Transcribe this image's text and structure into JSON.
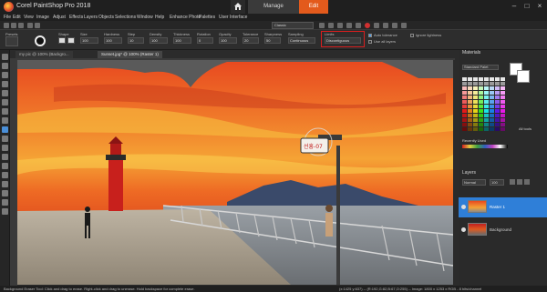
{
  "app": {
    "title": "Corel PaintShop Pro 2018"
  },
  "tabs": {
    "manage": "Manage",
    "edit": "Edit"
  },
  "menu": [
    "File",
    "Edit",
    "View",
    "Image",
    "Adjust",
    "Effects",
    "Layers",
    "Objects",
    "Selections",
    "Window",
    "Help",
    "Enhance Photo",
    "Palettes",
    "User Interface"
  ],
  "toolbar": {
    "workspace_combo": "Classic"
  },
  "options": {
    "labels": {
      "presets": "Presets",
      "shape": "Shape",
      "size": "Size",
      "hardness": "Hardness",
      "step": "Step",
      "density": "Density",
      "thickness": "Thickness",
      "rotation": "Rotation",
      "opacity": "Opacity",
      "tolerance": "Tolerance",
      "sharpness": "Sharpness",
      "sampling": "Sampling",
      "limits": "Limits"
    },
    "values": {
      "size": "100",
      "hardness": "100",
      "step": "10",
      "density": "100",
      "thickness": "100",
      "rotation": "0",
      "opacity": "100",
      "tolerance": "20",
      "sharpness": "50",
      "sampling": "Continuous",
      "limits": "Discontiguous"
    },
    "checks": {
      "auto_tolerance": "Auto tolerance",
      "use_all_layers": "Use all layers",
      "ignore_lightness": "Ignore lightness"
    }
  },
  "documents": {
    "tab1": "my pic @ 100% (Backgro...",
    "tab2": "Sunset.jpg* @ 100% (Raster 1)"
  },
  "palettes": {
    "materials_title": "Materials",
    "frame_label": "Standard Palet",
    "recent_label": "Recently Used",
    "all_tools": "All tools"
  },
  "layers": {
    "title": "Layers",
    "blend_mode": "Normal",
    "opacity": "100",
    "items": [
      {
        "name": "Raster 1"
      },
      {
        "name": "Background"
      }
    ]
  },
  "canvas": {
    "sign_text": "선흥-07"
  },
  "status": {
    "hint": "Background Eraser Tool: Click and drag to erase. Right-click and drag to unerase. Hold backspace for complete erase.",
    "info": "(x:1425 y:637) -- (R:192,G:82,B:67,O:255) -- Image: 1800 x 1253 x RGB - 8 bits/channel"
  },
  "colors": {
    "accent": "#e35a1c",
    "sky_orange": "#f07a2a",
    "highlight_red": "#d81e1e",
    "lighthouse_red": "#c8201c"
  }
}
